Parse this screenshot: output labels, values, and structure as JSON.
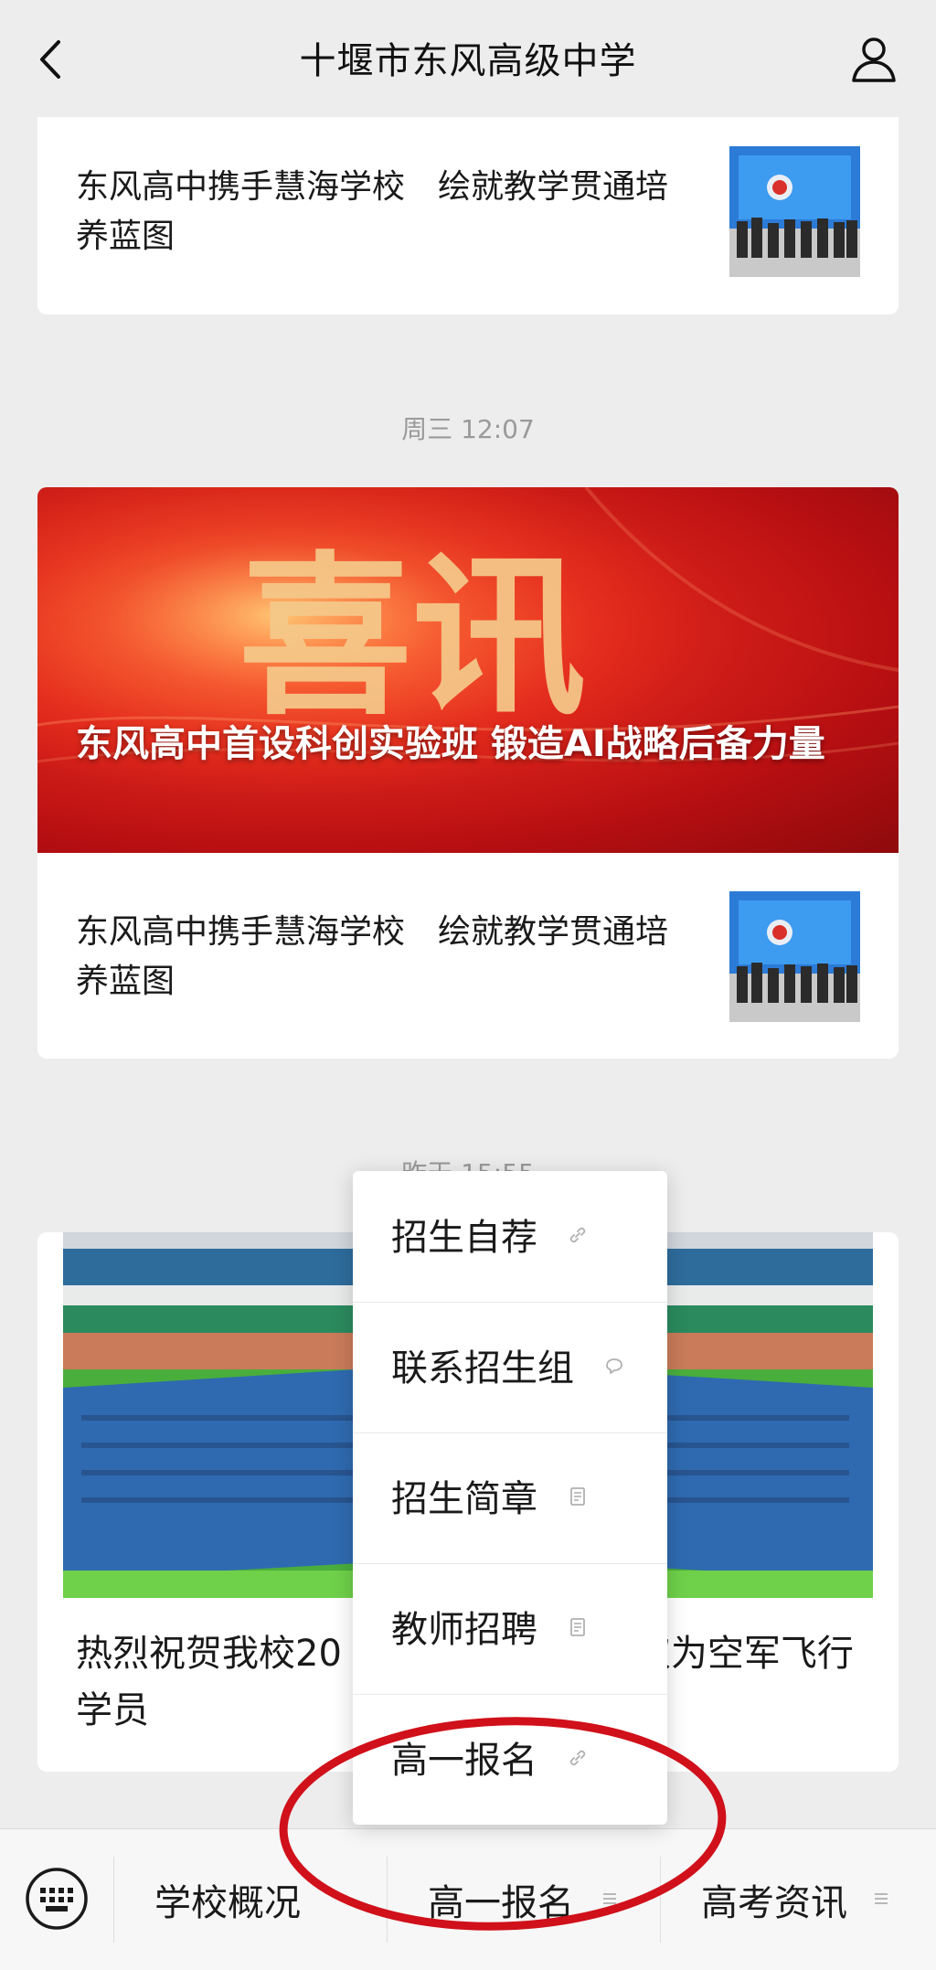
{
  "header": {
    "title": "十堰市东风高级中学"
  },
  "cards": [
    {
      "row_text": "东风高中携手慧海学校　绘就教学贯通培养蓝图"
    }
  ],
  "timestamps": [
    "周三 12:07",
    "昨天 15:55"
  ],
  "card2": {
    "banner_title": "东风高中首设科创实验班 锻造AI战略后备力量",
    "banner_art_text": "喜讯",
    "row_text": "东风高中携手慧海学校　绘就教学贯通培养蓝图"
  },
  "card3": {
    "caption": "热烈祝贺我校20　　　　　　　　取为空军飞行学员"
  },
  "popup_menu": {
    "items": [
      {
        "label": "招生自荐",
        "icon": "link-icon"
      },
      {
        "label": "联系招生组",
        "icon": "message-icon"
      },
      {
        "label": "招生简章",
        "icon": "article-icon"
      },
      {
        "label": "教师招聘",
        "icon": "article-icon"
      },
      {
        "label": "高一报名",
        "icon": "link-icon"
      }
    ]
  },
  "bottom_menu": {
    "items": [
      {
        "label": "学校概况"
      },
      {
        "label": "高一报名"
      },
      {
        "label": "高考资讯"
      }
    ]
  },
  "colors": {
    "annotation_circle": "#d0101a",
    "banner_red": "#c8161b",
    "page_bg": "#ededed"
  }
}
